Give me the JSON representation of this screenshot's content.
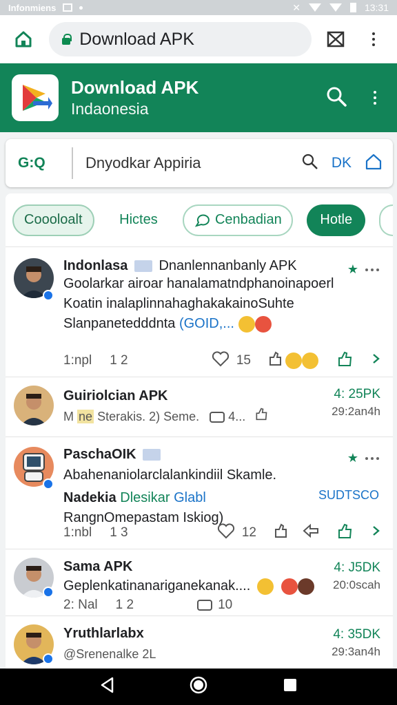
{
  "status": {
    "carrier": "Infonmiens",
    "time": "13:31"
  },
  "browser": {
    "url_title": "Download APK"
  },
  "app": {
    "title": "Download APK",
    "subtitle": "Indaonesia",
    "brand_color": "#128458"
  },
  "search": {
    "code": "G:Q",
    "query": "Dnyodkar Appiria",
    "dk": "DK"
  },
  "chips": [
    "Coooloalt",
    "Hictes",
    "Cenbadian",
    "Hotle"
  ],
  "posts": [
    {
      "name": "Indonlasa",
      "title_after": "Dnanlennanbanly APK",
      "line1": "Goolarkar airoar hanalamatndphanoinapoerl",
      "line2": "Koatin inalaplinnahaghakakainoSuhte",
      "line3_prefix": "Slanpanetedddnta",
      "line3_tag": "(GOID,...",
      "meta_left": "1:npl",
      "meta_num": "1 2",
      "likes": "15"
    },
    {
      "name": "Guiriolcian APK",
      "line1_prefix": "M",
      "line1_tag": "ne",
      "line1_text": "Sterakis.",
      "line1_num": "2)",
      "line1_tail": "Seme.",
      "line1_count": "4...",
      "right_top": "4: 25PK",
      "right_bottom": "29:2an4h"
    },
    {
      "name": "PaschaOIK",
      "line1": "Abahenaniolarclalankindiil Skamle.",
      "sub_name": "Nadekia",
      "sub_tag": "Dlesikar",
      "sub_tag2": "Glabl",
      "line3": "RangnOmepastam Iskiog)",
      "right_tag": "SUDTSCO",
      "meta_left": "1:nbl",
      "meta_num": "1 3",
      "likes": "12"
    },
    {
      "name": "Sama APK",
      "line1": "Geplenkatinanariganekanak....",
      "meta_left": "2: Nal",
      "meta_num": "1 2",
      "comments": "10",
      "right_top": "4: J5DK",
      "right_bottom": "20:0scah"
    },
    {
      "name": "Yruthlarlabx",
      "line1": "@Srenenalke",
      "line1_num": "2L",
      "right_top": "4: 35DK",
      "right_bottom": "29:3an4h"
    }
  ]
}
